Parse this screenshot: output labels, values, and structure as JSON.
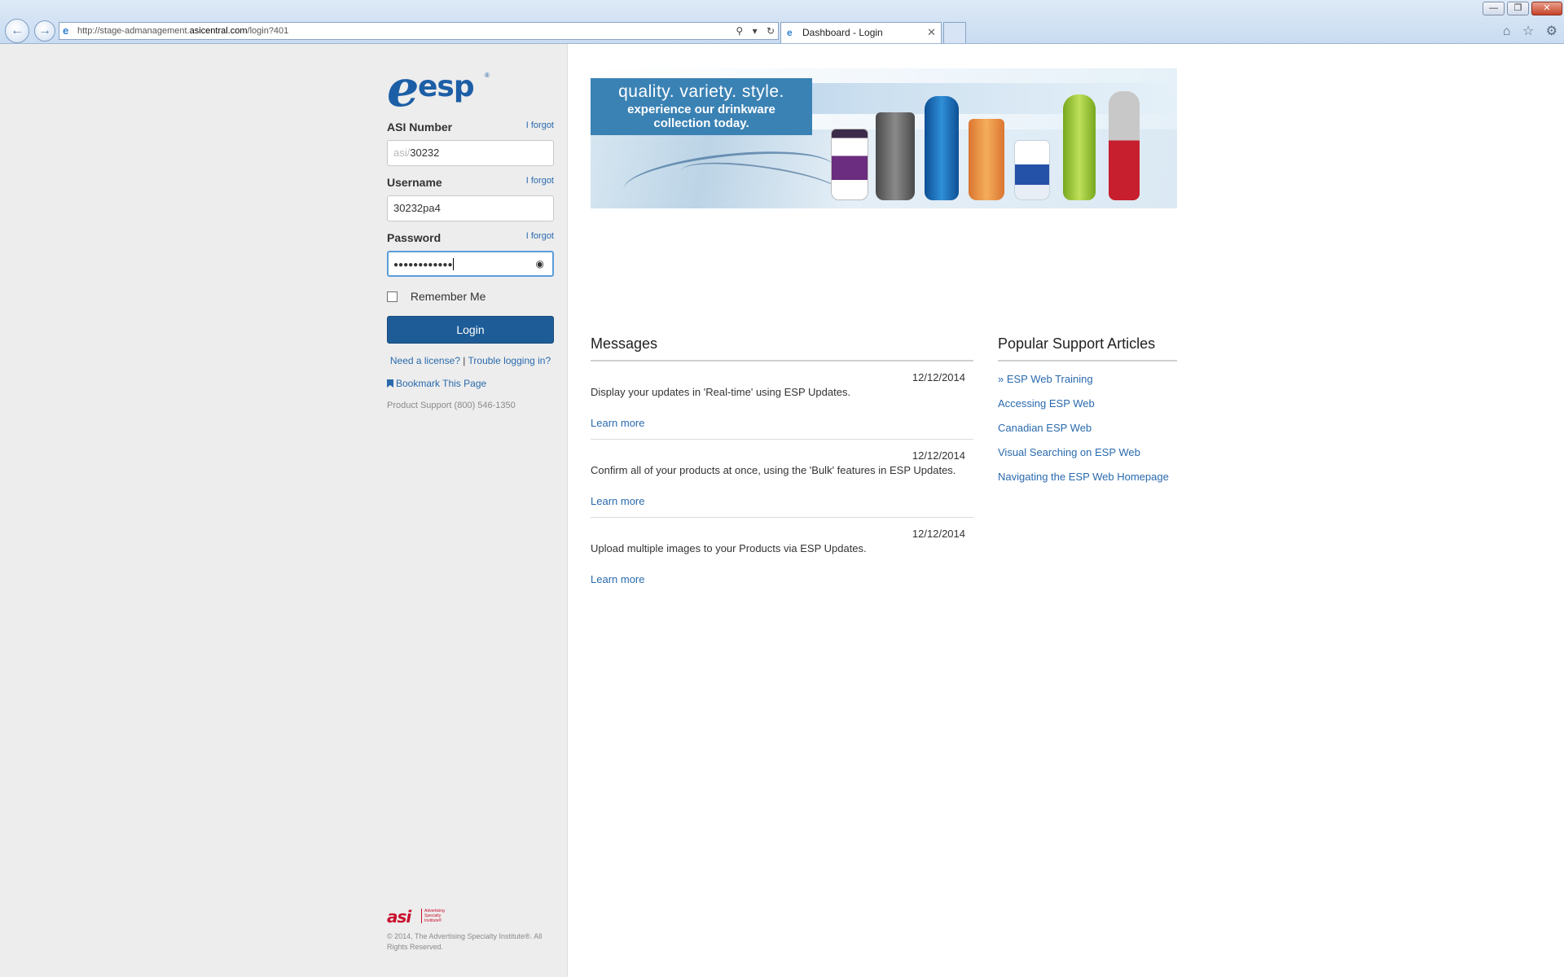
{
  "browser": {
    "url_prefix": "http://stage-admanagement.",
    "url_host": "asicentral.com",
    "url_path": "/login?401",
    "tab_title": "Dashboard - Login"
  },
  "login": {
    "asi_label": "ASI Number",
    "asi_prefix": "asi/",
    "asi_value": "30232",
    "username_label": "Username",
    "username_value": "30232pa4",
    "password_label": "Password",
    "password_mask": "●●●●●●●●●●●●",
    "forgot_label": "I forgot",
    "remember_label": "Remember Me",
    "remember_checked": false,
    "login_button": "Login",
    "need_license": "Need a license?",
    "separator": "|",
    "trouble": "Trouble logging in?",
    "bookmark": "Bookmark This Page",
    "support_phone": "Product Support (800) 546-1350"
  },
  "logo": {
    "mark": "e",
    "text": "esp",
    "reg": "®"
  },
  "footer": {
    "asi_mark": "asi",
    "asi_name": "Advertising Specialty Institute®",
    "copyright": "© 2014, The Advertising Specialty Institute®. All Rights Reserved."
  },
  "banner": {
    "line1": "quality. variety. style.",
    "line2": "experience our drinkware",
    "line3": "collection today."
  },
  "messages": {
    "title": "Messages",
    "items": [
      {
        "date": "12/12/2014",
        "text": "Display your updates in 'Real-time' using ESP Updates.",
        "link": "Learn more"
      },
      {
        "date": "12/12/2014",
        "text": "Confirm all of your products at once, using the 'Bulk' features in ESP Updates.",
        "link": "Learn more"
      },
      {
        "date": "12/12/2014",
        "text": "Upload multiple images to your Products via ESP Updates.",
        "link": "Learn more"
      }
    ]
  },
  "support_articles": {
    "title": "Popular Support Articles",
    "items": [
      "» ESP Web Training",
      "Accessing ESP Web",
      "Canadian ESP Web",
      "Visual Searching on ESP Web",
      "Navigating the ESP Web Homepage"
    ]
  },
  "icons": {
    "back": "back-arrow-icon",
    "forward": "forward-arrow-icon",
    "search": "search-icon",
    "refresh": "refresh-icon",
    "close": "close-icon",
    "home": "home-icon",
    "favorites": "star-icon",
    "settings": "gear-icon",
    "eye": "eye-icon",
    "bookmark": "bookmark-icon"
  },
  "colors": {
    "brand_blue": "#1c5fa6",
    "button_blue": "#1e5c97",
    "link_blue": "#2a6aad",
    "asi_red": "#c8102e"
  }
}
